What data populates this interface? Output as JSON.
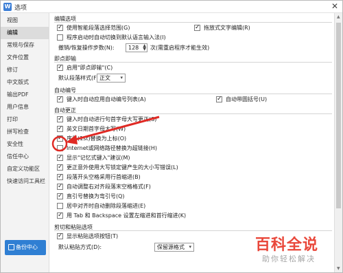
{
  "window": {
    "title": "选项",
    "close_glyph": "✕"
  },
  "sidebar": {
    "items": [
      {
        "label": "视图"
      },
      {
        "label": "编辑",
        "active": true
      },
      {
        "label": "常规与保存"
      },
      {
        "label": "文件位置"
      },
      {
        "label": "修订"
      },
      {
        "label": "中文版式"
      },
      {
        "label": "输出PDF"
      },
      {
        "label": "用户信息"
      },
      {
        "label": "打印"
      },
      {
        "label": "拼写检查"
      },
      {
        "label": "安全性"
      },
      {
        "label": "信任中心"
      },
      {
        "label": "自定义功能区"
      },
      {
        "label": "快速访问工具栏"
      }
    ],
    "backup_button": "备份中心"
  },
  "sections": {
    "edit_options": {
      "title": "编辑选项",
      "smart_select": {
        "label": "使用智能段落选择范围(G)",
        "checked": true
      },
      "drag_edit": {
        "label": "拖放式文字编辑(R)",
        "checked": true
      },
      "auto_ime": {
        "label": "程序启动时自动切换到默认语言输入法(I)",
        "checked": false
      },
      "undo_steps": {
        "label": "撤销/恢复操作步数(N):",
        "value": "128",
        "suffix": "次(需重启程序才能生效)"
      }
    },
    "click_type": {
      "title": "即点即输",
      "enable": {
        "label": "启用\"即点即输\"(C)",
        "checked": true
      },
      "default_style": {
        "label": "默认段落样式(F):",
        "value": "正文"
      }
    },
    "auto_number": {
      "title": "自动编号",
      "auto_list": {
        "label": "键入时自动应用自动编号列表(A)",
        "checked": true
      },
      "auto_bullet": {
        "label": "自动带圆括号(U)",
        "checked": true
      }
    },
    "auto_correct": {
      "title": "自动更正",
      "items": [
        {
          "label": "键入时自动进行句首字母大写更正(S)",
          "checked": true
        },
        {
          "label": "英文日期首字母大写(W)",
          "checked": true
        },
        {
          "label": "序号(1st)替换为上标(O)",
          "checked": true
        },
        {
          "label": "Internet或网络路径替换为超链接(H)",
          "checked": false
        },
        {
          "label": "显示\"记忆式键入\"建议(M)",
          "checked": true
        },
        {
          "label": "更正意外使用大写锁定键产生的大小写错误(L)",
          "checked": true
        },
        {
          "label": "段落开头空格采用行首缩进(B)",
          "checked": true
        },
        {
          "label": "自动调整右对齐段落末空格格式(F)",
          "checked": true
        },
        {
          "label": "直引号替换为弯引号(Q)",
          "checked": true
        },
        {
          "label": "居中对齐时自动删除段落缩进(E)",
          "checked": false
        },
        {
          "label": "用 Tab 和 Backspace 设置左缩进和首行缩进(K)",
          "checked": true
        }
      ]
    },
    "cut_paste": {
      "title": "剪切和粘贴选项",
      "show_button": {
        "label": "显示粘贴选项按钮(T)",
        "checked": true
      },
      "default_paste": {
        "label": "默认粘贴方式(D):",
        "value": "保留源格式"
      }
    }
  },
  "watermark": {
    "main": "百科全说",
    "sub": "助你轻松解决"
  },
  "colors": {
    "accent": "#2f7fd3",
    "annotation": "#e02a24",
    "watermark": "#e9473a"
  }
}
